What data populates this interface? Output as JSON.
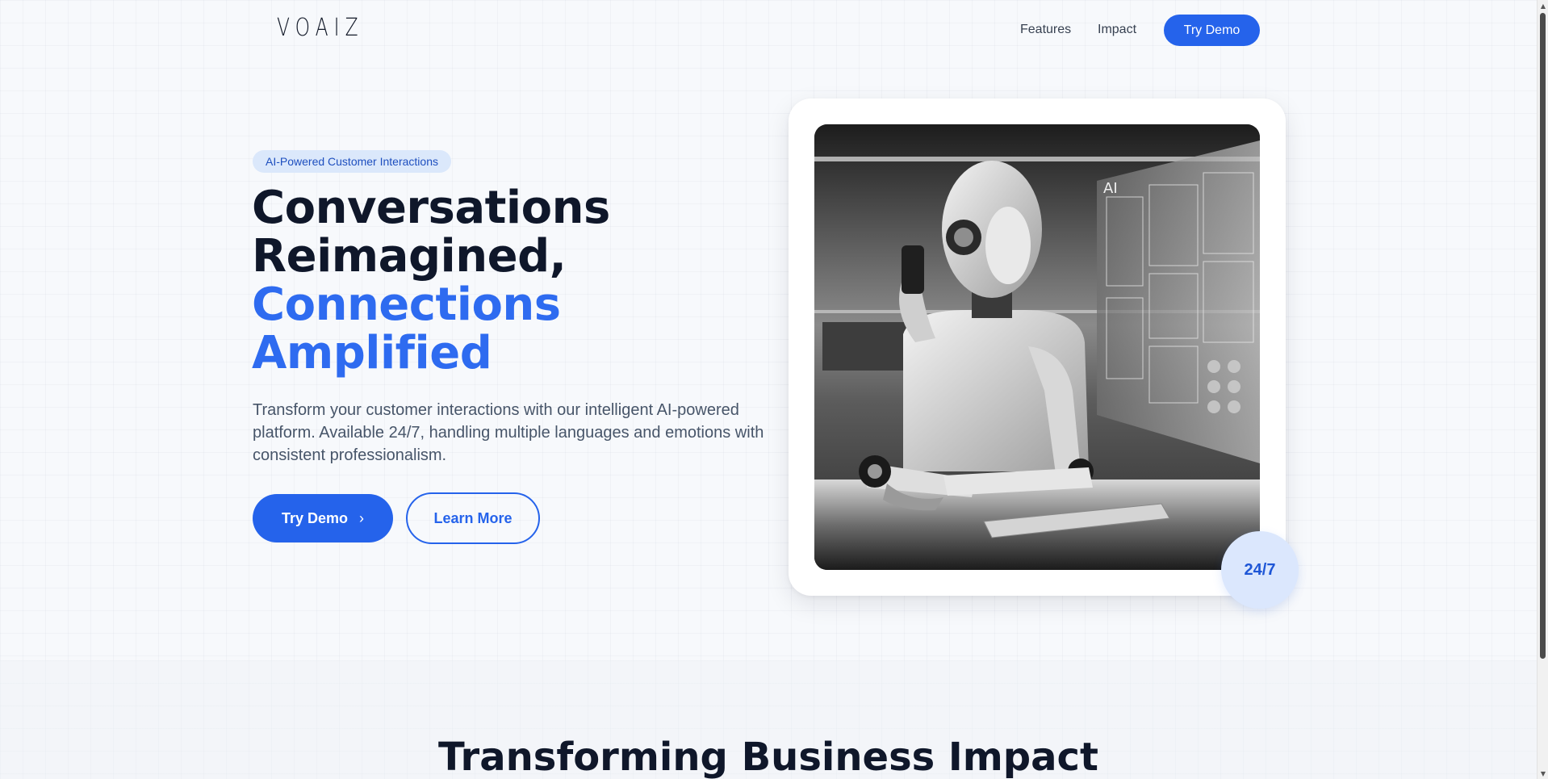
{
  "nav": {
    "logo": "VOAIZ",
    "links": [
      "Features",
      "Impact"
    ],
    "cta_label": "Try Demo",
    "brand_color": "#2563eb"
  },
  "hero": {
    "badge": "AI-Powered Customer Interactions",
    "headline_lines": [
      "Conversations",
      "Reimagined,",
      "Connections",
      "Amplified"
    ],
    "lead": "Transform your customer interactions with our intelligent AI-powered platform. Available 24/7, handling multiple languages and emotions with consistent professionalism.",
    "primary_button": "Try Demo",
    "primary_button_icon": "chevron-right-icon",
    "primary_button_glyph": "›",
    "secondary_button": "Learn More",
    "stat": "24/7",
    "image_subject": "humanoid robot on phone at desk with holographic AI screens",
    "screen_label": "AI"
  },
  "section": {
    "title": "Transforming Business Impact"
  },
  "scrollbar": {
    "up_glyph": "▲",
    "down_glyph": "▼"
  }
}
